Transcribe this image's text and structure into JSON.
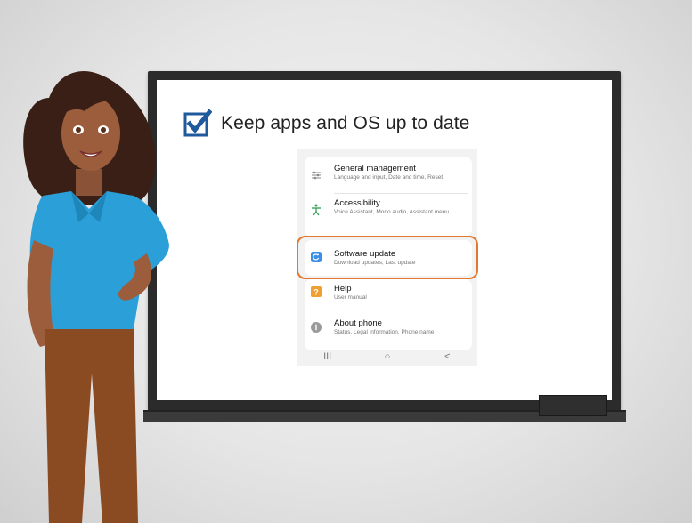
{
  "slide": {
    "heading": "Keep apps and OS up to date"
  },
  "settings": {
    "items": [
      {
        "title": "General management",
        "subtitle": "Language and input, Date and time, Reset",
        "icon": "sliders-icon"
      },
      {
        "title": "Accessibility",
        "subtitle": "Voice Assistant, Mono audio, Assistant menu",
        "icon": "accessibility-icon"
      },
      {
        "title": "Software update",
        "subtitle": "Download updates, Last update",
        "icon": "refresh-icon"
      },
      {
        "title": "Help",
        "subtitle": "User manual",
        "icon": "help-icon"
      },
      {
        "title": "About phone",
        "subtitle": "Status, Legal information, Phone name",
        "icon": "info-icon"
      }
    ],
    "highlighted": "Software update",
    "highlight_color": "#e0782d"
  },
  "navbar": {
    "recents": "III",
    "home": "○",
    "back": "<"
  },
  "colors": {
    "checkbox": "#1f5a9c",
    "board_frame": "#2b2b2b"
  }
}
